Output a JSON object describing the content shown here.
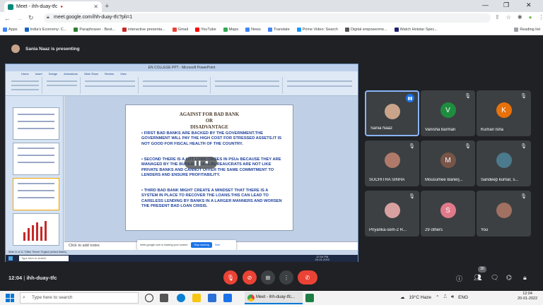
{
  "browser": {
    "tab_title": "Meet - ihh-duay-tfc",
    "url": "meet.google.com/ihh-duay-tfc?pli=1",
    "bookmarks": [
      "Apps",
      "India's Economy: C...",
      "Paraphraser - Best...",
      "interactive presenta...",
      "Gmail",
      "YouTube",
      "Maps",
      "News",
      "Translate",
      "Prime Video: Search",
      "Digital empowerme...",
      "Watch Hotstar Spec..."
    ],
    "reading_list": "Reading list"
  },
  "meet": {
    "presenting_text": "Sania Naaz is presenting",
    "meeting_time": "12:04",
    "meeting_code": "ihh-duay-tfc",
    "people_count": "30",
    "participants": [
      {
        "name": "Sania Naaz",
        "initial": "",
        "color": "#c9a48a",
        "muted": false,
        "active": true
      },
      {
        "name": "Vanisha barman",
        "initial": "V",
        "color": "#1e8e3e",
        "muted": true,
        "active": false
      },
      {
        "name": "Kumari Isha",
        "initial": "K",
        "color": "#e8710a",
        "muted": true,
        "active": false
      },
      {
        "name": "SUCHITRA SINHA",
        "initial": "",
        "color": "#b07a6a",
        "muted": true,
        "active": false
      },
      {
        "name": "Mousumee Banerj...",
        "initial": "M",
        "color": "#795548",
        "muted": true,
        "active": false
      },
      {
        "name": "Sandeep kumar, s...",
        "initial": "",
        "color": "#4b7a8c",
        "muted": true,
        "active": false
      },
      {
        "name": "Priyanka-sem-2 R...",
        "initial": "",
        "color": "#d9a0a0",
        "muted": true,
        "active": false
      },
      {
        "name": "29 others",
        "initial": "S",
        "color": "#e07a8a",
        "muted": false,
        "active": false
      },
      {
        "name": "You",
        "initial": "",
        "color": "#a07060",
        "muted": true,
        "active": false
      }
    ]
  },
  "shared_screen": {
    "window_title": "EN COLLEGE PPT - Microsoft PowerPoint",
    "ribbon_tabs": [
      "Home",
      "Insert",
      "Design",
      "Animations",
      "Slide Show",
      "Review",
      "View"
    ],
    "slide": {
      "title_line1": "AGAINST FOR BAD BANK",
      "title_line2": "OR",
      "title_line3": "DISADVANTAGE",
      "bullets": [
        "• FIRST BAD BANKS ARE BACKED BY THE GOVERNMENT.THE GOVERNMENT WILL PAY THE HIGH COST FOR STRESSED ASSETS.IT IS NOT GOOD FOR FISCAL HEALTH OF THE COUNTRY.",
        "• SECOND THERE IS A LOT LOAN CRISES IN PSUs BECAUSE THEY ARE MANAGED BY THE BUREAUCRATS,BUREAUCRATS ARE NOT LIKE PRIVATE BANKS AND CANNOT OFFER THE SAME COMMITMENT TO LENDERS AND ENSURE PROFITABILITY.",
        "• THIRD BAD BANK MIGHT CREATE A MINDSET THAT THERE IS A SYSTEM IN PLACE TO RECOVER THE LOANS.THIS CAN LEAD TO CARELESS LENDING BY BANKS IN A LARGER MANNERS AND WORSEN THE  PRESENT BAD LOAN CRISIS."
      ]
    },
    "notes_placeholder": "Click to add notes",
    "status_text": "Slide 11 of 11   \"Office Theme\"   English (United States)",
    "sharing_banner": "meet.google.com is sharing your screen.",
    "stop_sharing": "Stop sharing",
    "hide": "Hide",
    "inner_search": "Type here to search",
    "inner_time": "12:04 PM",
    "inner_date": "20-01-2022"
  },
  "taskbar": {
    "search_placeholder": "Type here to search",
    "active_window": "Meet - ihh-duay-tfc...",
    "weather": "19°C  Haze",
    "language": "ENG",
    "time": "12:04",
    "date": "20-01-2022"
  }
}
